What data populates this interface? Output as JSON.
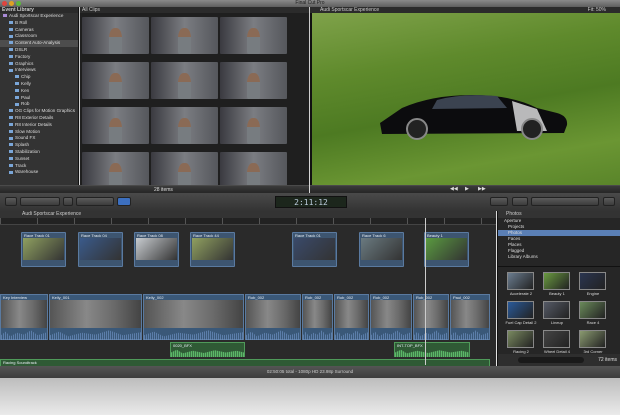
{
  "window": {
    "title": "Final Cut Pro"
  },
  "library": {
    "header": "Event Library",
    "items": [
      {
        "label": "Audi Sportscar Experience",
        "level": 0
      },
      {
        "label": "B Roll",
        "level": 1
      },
      {
        "label": "Cameras",
        "level": 1
      },
      {
        "label": "Classroom",
        "level": 1
      },
      {
        "label": "Content Auto-Analysis",
        "level": 1,
        "selected": true
      },
      {
        "label": "DSLR",
        "level": 1
      },
      {
        "label": "Factory",
        "level": 1
      },
      {
        "label": "Graphics",
        "level": 1
      },
      {
        "label": "Interviews",
        "level": 1
      },
      {
        "label": "Chip",
        "level": 2
      },
      {
        "label": "Kelly",
        "level": 2
      },
      {
        "label": "Ken",
        "level": 2
      },
      {
        "label": "Paul",
        "level": 2
      },
      {
        "label": "Rob",
        "level": 2
      },
      {
        "label": "OG Clips for Motion Graphics",
        "level": 1
      },
      {
        "label": "R8 Exterior Details",
        "level": 1
      },
      {
        "label": "R8 Interior Details",
        "level": 1
      },
      {
        "label": "Slow Motion",
        "level": 1
      },
      {
        "label": "Sound FX",
        "level": 1
      },
      {
        "label": "Splash",
        "level": 1
      },
      {
        "label": "Stabilization",
        "level": 1
      },
      {
        "label": "Sunset",
        "level": 1
      },
      {
        "label": "Track",
        "level": 1
      },
      {
        "label": "Warehouse",
        "level": 1
      }
    ]
  },
  "browser": {
    "header": "All Clips",
    "count": "28 items"
  },
  "viewer": {
    "title": "Audi Sportscar Experience",
    "zoom": "Fit: 50%"
  },
  "toolbar": {
    "timecode": "2:11:12"
  },
  "timeline": {
    "project": "Audi Sportscar Experience",
    "connected": [
      "Race Track 01",
      "Race Track 04",
      "Race Track 08",
      "Race Track 44",
      "Race Track 01",
      "Race Track 6",
      "Beauty 1"
    ],
    "primary": [
      "Key Interview",
      "Kelly_001",
      "Kelly_002",
      "Rob_002",
      "Rob_002",
      "Rob_002",
      "Rob_002",
      "Rob_002",
      "Paul_002"
    ],
    "audio": [
      "0020_BFX",
      "INT-TOP_BFX"
    ],
    "soundtrack": "Racing Soundtrack"
  },
  "photos": {
    "header": "Photos",
    "tree": [
      "Aperture",
      "Projects",
      "Photos",
      "Faces",
      "Places",
      "Flagged",
      "Library Albums"
    ],
    "selected": "Photos",
    "items": [
      "Accelerate 2",
      "Beauty 1",
      "Engine",
      "Fuel Cap Detail 2",
      "Lineup",
      "Race 4",
      "Racing 2",
      "Wheel Detail 4",
      "3rd Corner"
    ],
    "count": "72 items"
  },
  "status": {
    "text": "02:50:05 total - 1080p HD 23.98p Surround"
  },
  "colors": {
    "clip": "#3d5570",
    "audio": "#2f5a35",
    "selection": "#5a7fb5"
  }
}
